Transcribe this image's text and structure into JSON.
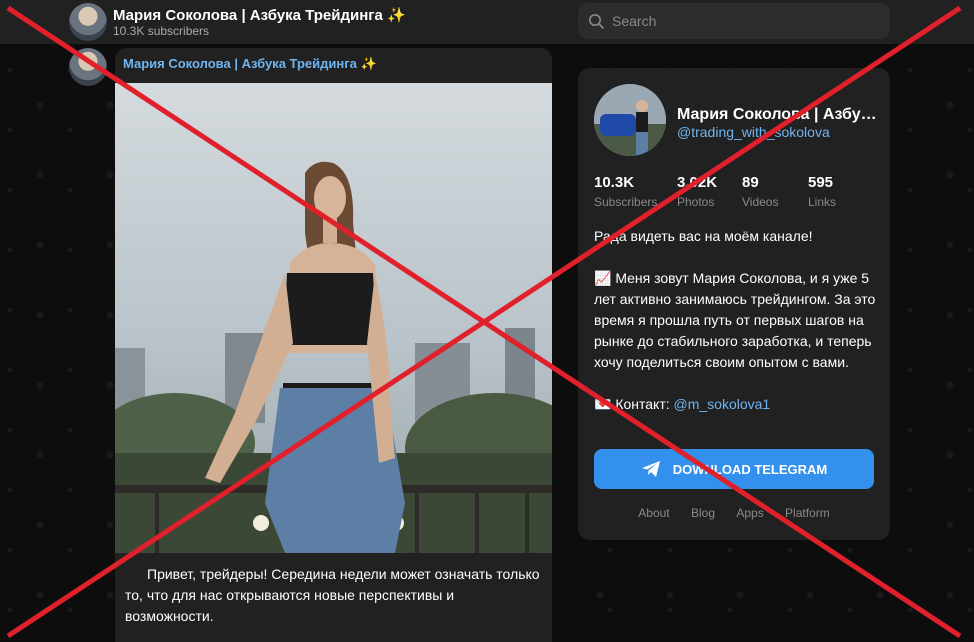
{
  "header": {
    "channel_title": "Мария Соколова | Азбука Трейдинга ✨",
    "subscribers": "10.3K subscribers",
    "search_placeholder": "Search"
  },
  "post": {
    "author": "Мария Соколова | Азбука Трейдинга ✨",
    "text": "Привет, трейдеры! Середина недели может означать только то, что для нас открываются новые перспективы и возможности."
  },
  "channel_card": {
    "name": "Мария Соколова | Азбука Трейдинга ✨",
    "handle": "@trading_with_sokolova",
    "stats": [
      {
        "value": "10.3K",
        "label": "Subscribers"
      },
      {
        "value": "3.02K",
        "label": "Photos"
      },
      {
        "value": "89",
        "label": "Videos"
      },
      {
        "value": "595",
        "label": "Links"
      }
    ],
    "description_greeting": "Рада видеть вас на моём канале!",
    "description_body": "📈 Меня зовут Мария Соколова, и я уже 5 лет активно занимаюсь трейдингом. За это время я прошла путь от первых шагов на рынке до стабильного заработка, и теперь хочу поделиться своим опытом с вами.",
    "contact_label": "💌 Контакт: ",
    "contact_handle": "@m_sokolova1",
    "download_button": "DOWNLOAD TELEGRAM",
    "footer_links": [
      "About",
      "Blog",
      "Apps",
      "Platform"
    ]
  },
  "colors": {
    "accent_link": "#6fb5ef",
    "button_blue": "#3390ec",
    "cross_red": "#e0202a"
  }
}
